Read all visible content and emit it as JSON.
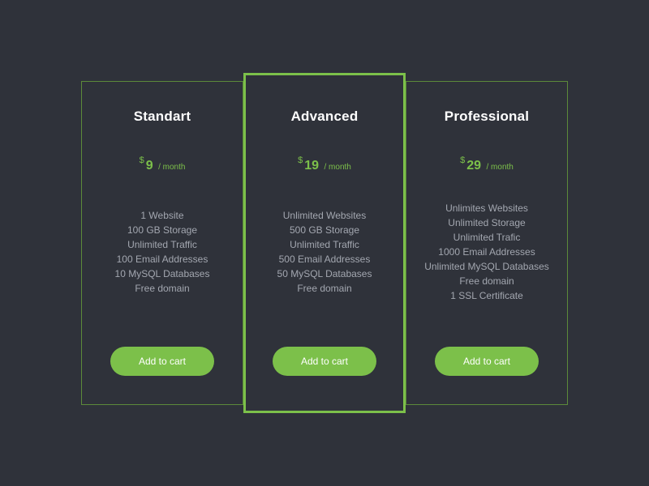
{
  "plans": [
    {
      "title": "Standart",
      "currency": "$",
      "amount": "9",
      "period": "/ month",
      "features": [
        "1 Website",
        "100 GB Storage",
        "Unlimited Traffic",
        "100 Email Addresses",
        "10 MySQL Databases",
        "Free domain"
      ],
      "button_label": "Add to cart",
      "highlighted": false
    },
    {
      "title": "Advanced",
      "currency": "$",
      "amount": "19",
      "period": "/ month",
      "features": [
        "Unlimited Websites",
        "500 GB Storage",
        "Unlimited Traffic",
        "500 Email Addresses",
        "50 MySQL Databases",
        "Free domain"
      ],
      "button_label": "Add to cart",
      "highlighted": true
    },
    {
      "title": "Professional",
      "currency": "$",
      "amount": "29",
      "period": "/ month",
      "features": [
        "Unlimites Websites",
        "Unlimited Storage",
        "Unlimited Trafic",
        "1000 Email Addresses",
        "Unlimited MySQL Databases",
        "Free domain",
        "1 SSL Certificate"
      ],
      "button_label": "Add to cart",
      "highlighted": false
    }
  ],
  "colors": {
    "background": "#2f323a",
    "accent": "#7cc04a",
    "card_border": "#5c8a3a",
    "feature_text": "#a3a7b0",
    "title_text": "#ffffff"
  }
}
